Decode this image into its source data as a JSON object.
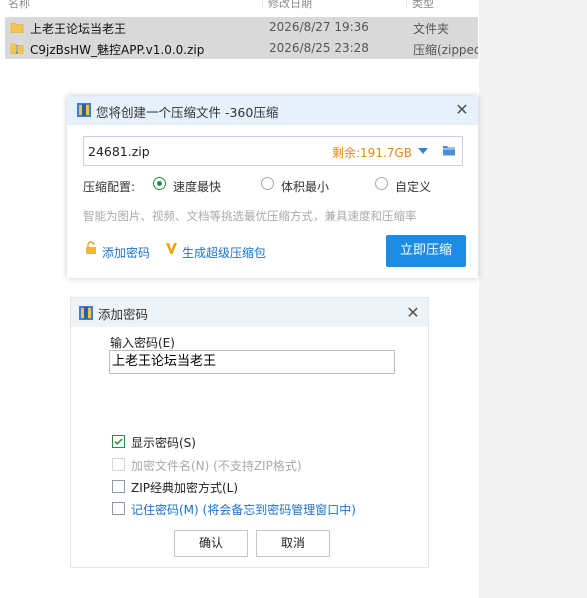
{
  "explorer": {
    "columns": [
      "名称",
      "修改日期",
      "类型"
    ],
    "files": [
      {
        "name": "上老王论坛当老王",
        "date": "2026/8/27 19:36",
        "type": "文件夹",
        "icon": "folder-icon"
      },
      {
        "name": "C9jzBsHW_魅控APP.v1.0.0.zip",
        "date": "2026/8/25 23:28",
        "type": "压缩(zipped",
        "icon": "zip-folder-icon"
      }
    ]
  },
  "compress_dialog": {
    "title": "您将创建一个压缩文件 -360压缩",
    "filename": "24681.zip",
    "free_space": "剩余:191.7GB",
    "config_label": "压缩配置:",
    "options": [
      "速度最快",
      "体积最小",
      "自定义"
    ],
    "selected_option": "速度最快",
    "hint": "智能为图片、视频、文档等挑选最优压缩方式，兼具速度和压缩率",
    "add_password_link": "添加密码",
    "super_compress_link": "生成超级压缩包",
    "compress_button": "立即压缩",
    "accent_color": "#1a8ce5"
  },
  "password_dialog": {
    "title": "添加密码",
    "input_label": "输入密码(E)",
    "password_value": "上老王论坛当老王",
    "checkboxes": [
      {
        "label": "显示密码(S)",
        "checked": true,
        "enabled": true
      },
      {
        "label": "加密文件名(N) (不支持ZIP格式)",
        "checked": false,
        "enabled": false
      },
      {
        "label": "ZIP经典加密方式(L)",
        "checked": false,
        "enabled": true
      },
      {
        "label": "记住密码(M) (将会备忘到密码管理窗口中)",
        "checked": false,
        "enabled": true
      }
    ],
    "ok_button": "确认",
    "cancel_button": "取消"
  }
}
